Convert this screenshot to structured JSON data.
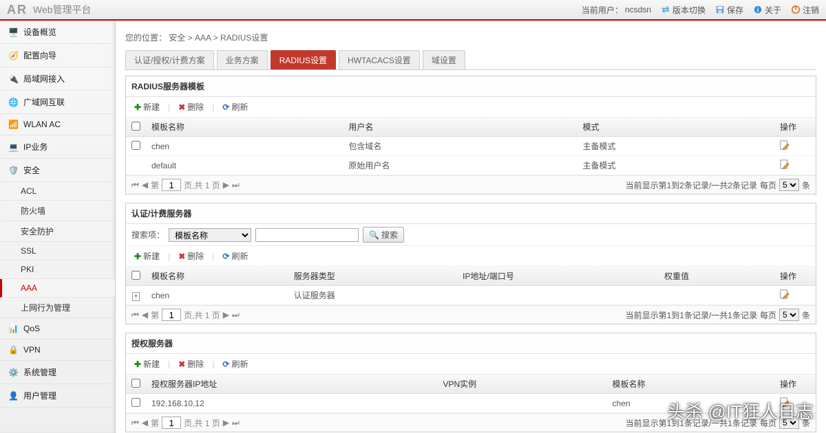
{
  "header": {
    "logo": "AR",
    "title": "Web管理平台",
    "current_user_label": "当前用户：",
    "current_user": "ncsdsn",
    "switch": "版本切换",
    "save": "保存",
    "about": "关于",
    "logout": "注销"
  },
  "sidebar": {
    "items": [
      {
        "label": "设备概览",
        "icon": "device"
      },
      {
        "label": "配置向导",
        "icon": "wizard"
      },
      {
        "label": "局域网接入",
        "icon": "lan"
      },
      {
        "label": "广域网互联",
        "icon": "wan"
      },
      {
        "label": "WLAN AC",
        "icon": "wlan"
      },
      {
        "label": "IP业务",
        "icon": "ip"
      },
      {
        "label": "安全",
        "icon": "security"
      }
    ],
    "security_subs": [
      "ACL",
      "防火墙",
      "安全防护",
      "SSL",
      "PKI",
      "AAA",
      "上网行为管理"
    ],
    "rest": [
      {
        "label": "QoS",
        "icon": "qos"
      },
      {
        "label": "VPN",
        "icon": "vpn"
      },
      {
        "label": "系统管理",
        "icon": "sys"
      },
      {
        "label": "用户管理",
        "icon": "user"
      }
    ]
  },
  "breadcrumb": {
    "prefix": "您的位置： ",
    "path": "安全 > AAA > RADIUS设置"
  },
  "tabs": [
    "认证/授权/计费方案",
    "业务方案",
    "RADIUS设置",
    "HWTACACS设置",
    "域设置"
  ],
  "actions": {
    "add": "新建",
    "delete": "删除",
    "refresh": "刷新",
    "search": "搜索"
  },
  "panel1": {
    "title": "RADIUS服务器模板",
    "cols": [
      "模板名称",
      "用户名",
      "模式",
      "操作"
    ],
    "rows": [
      {
        "c1": "chen",
        "c2": "包含域名",
        "c3": "主备模式"
      },
      {
        "c1": "default",
        "c2": "原始用户名",
        "c3": "主备模式"
      }
    ],
    "pager_text": "页,共 1 页",
    "pager_info": "当前显示第1到2条记录/一共2条记录",
    "per_page_label": "每页",
    "per_page": "5",
    "unit": "条",
    "page": "1",
    "di": "第"
  },
  "panel2": {
    "title": "认证/计费服务器",
    "search_label": "搜索项：",
    "search_option": "模板名称",
    "cols": [
      "模板名称",
      "服务器类型",
      "IP地址/端口号",
      "权重值",
      "操作"
    ],
    "rows": [
      {
        "c1": "chen",
        "c2": "认证服务器",
        "c3": "",
        "c4": ""
      }
    ],
    "pager_text": "页,共 1 页",
    "pager_info": "当前显示第1到1条记录/一共1条记录",
    "per_page_label": "每页",
    "per_page": "5",
    "unit": "条",
    "page": "1",
    "di": "第"
  },
  "panel3": {
    "title": "授权服务器",
    "cols": [
      "授权服务器IP地址",
      "VPN实例",
      "模板名称",
      "操作"
    ],
    "rows": [
      {
        "c1": "192.168.10.12",
        "c2": "",
        "c3": "chen"
      }
    ],
    "pager_text": "页,共 1 页",
    "pager_info": "当前显示第1到1条记录/一共1条记录",
    "per_page_label": "每页",
    "per_page": "5",
    "unit": "条",
    "page": "1",
    "di": "第"
  },
  "watermark": "头杀 @IT狂人日志"
}
